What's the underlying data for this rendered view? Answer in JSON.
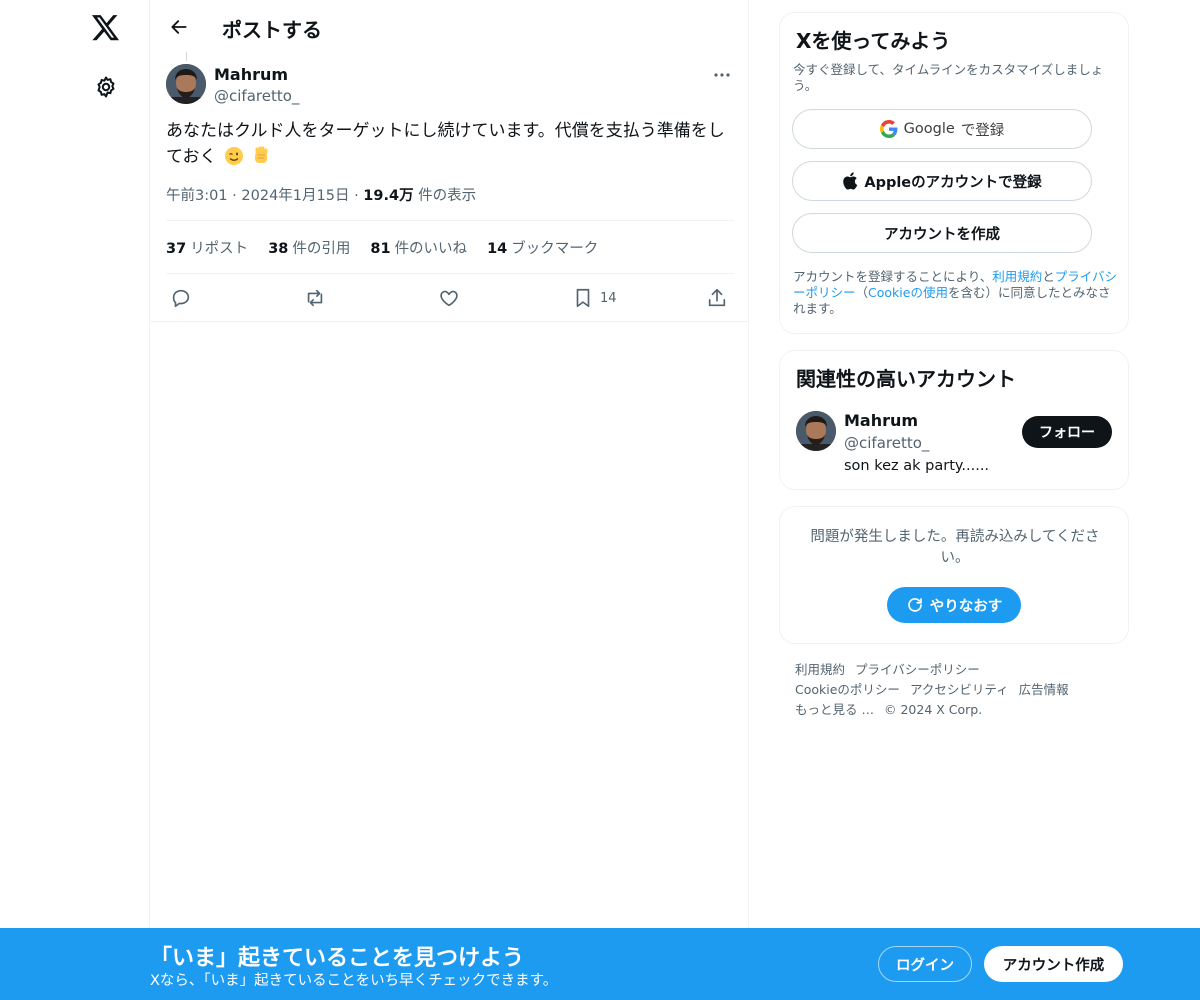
{
  "nav": {
    "logo_icon": "x-logo-icon",
    "settings_icon": "gear-icon"
  },
  "header": {
    "title": "ポストする",
    "back_icon": "arrow-left-icon"
  },
  "tweet": {
    "author_name": "Mahrum",
    "author_handle": "@cifaretto_",
    "text": "あなたはクルド人をターゲットにし続けています。代償を支払う準備をしておく",
    "emojis": [
      "winking-face",
      "raised-fist"
    ],
    "time": "午前3:01",
    "date": "2024年1月15日",
    "views_count": "19.4万",
    "views_label": "件の表示",
    "stats": [
      {
        "count": "37",
        "label": "リポスト"
      },
      {
        "count": "38",
        "label": "件の引用"
      },
      {
        "count": "81",
        "label": "件のいいね"
      },
      {
        "count": "14",
        "label": "ブックマーク"
      }
    ],
    "bookmark_count": "14"
  },
  "signup_card": {
    "title": "Xを使ってみよう",
    "subtitle": "今すぐ登録して、タイムラインをカスタマイズしましょう。",
    "google_brand": "Google",
    "google_suffix": "で登録",
    "apple_label": "Appleのアカウントで登録",
    "create_label": "アカウントを作成",
    "legal_prefix": "アカウントを登録することにより、",
    "legal_terms": "利用規約",
    "legal_and": "と",
    "legal_privacy": "プライバシーポリシー",
    "legal_paren_open": "（",
    "legal_cookie": "Cookieの使用",
    "legal_suffix": "を含む）に同意したとみなされます。"
  },
  "relevant": {
    "title": "関連性の高いアカウント",
    "name": "Mahrum",
    "handle": "@cifaretto_",
    "bio": "son kez ak party......",
    "follow_label": "フォロー"
  },
  "error_card": {
    "message": "問題が発生しました。再読み込みしてください。",
    "retry_label": "やりなおす"
  },
  "footer": {
    "links": [
      "利用規約",
      "プライバシーポリシー",
      "Cookieのポリシー",
      "アクセシビリティ",
      "広告情報",
      "もっと見る …"
    ],
    "copyright": "© 2024 X Corp."
  },
  "banner": {
    "title": "「いま」起きていることを見つけよう",
    "subtitle": "Xなら、「いま」起きていることをいち早くチェックできます。",
    "login_label": "ログイン",
    "signup_label": "アカウント作成"
  },
  "colors": {
    "accent": "#1d9bf0",
    "text": "#0f1419",
    "muted": "#536471",
    "border": "#eff3f4"
  }
}
